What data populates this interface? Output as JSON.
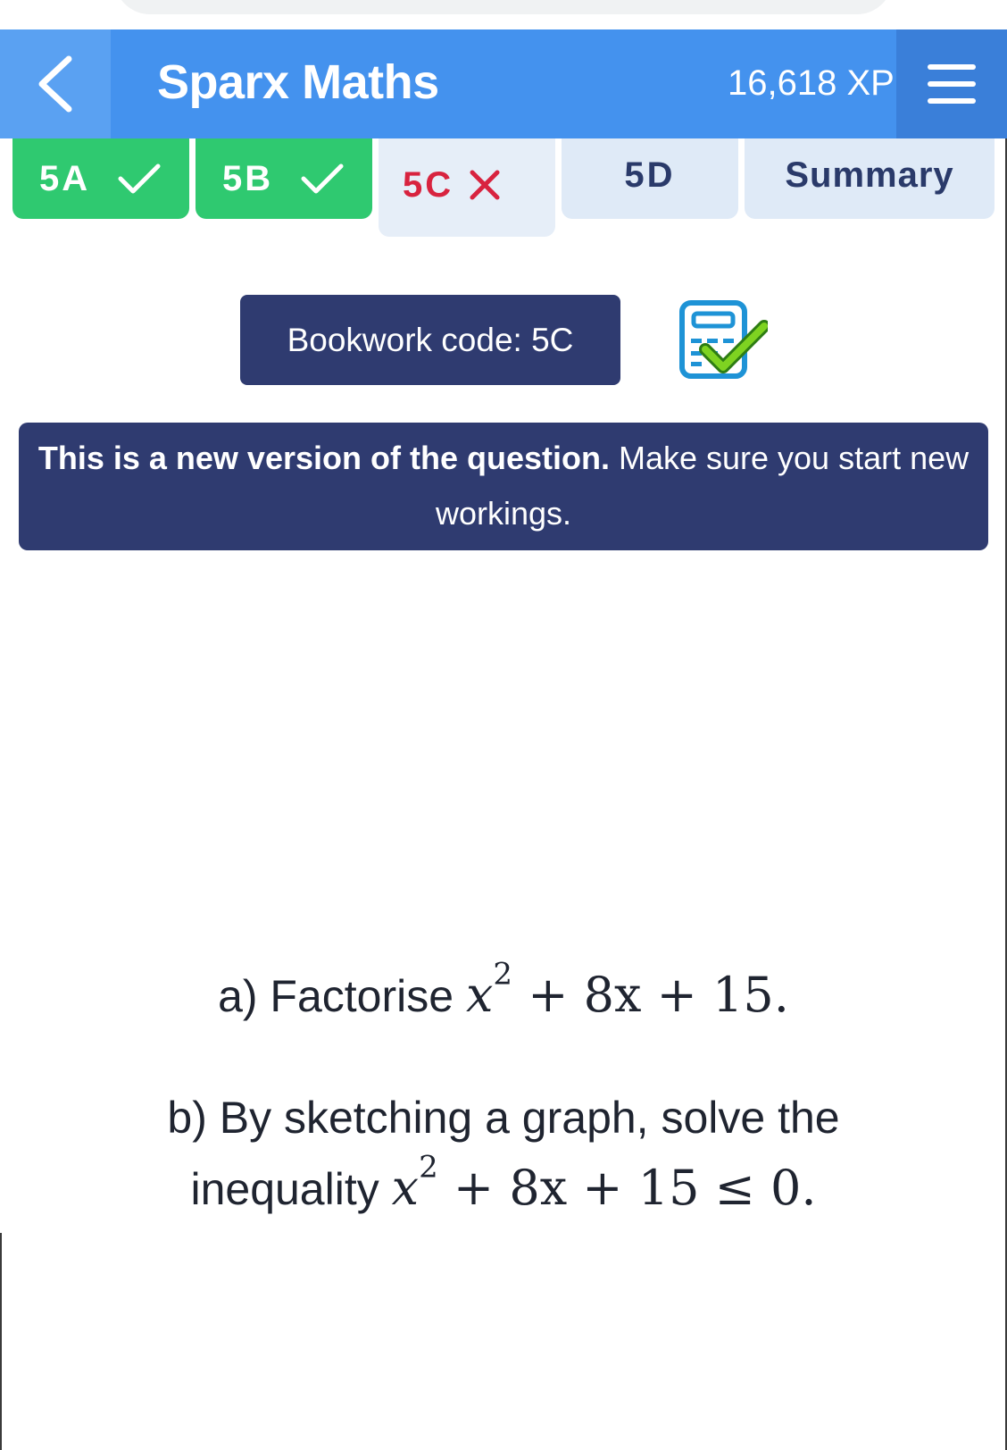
{
  "header": {
    "title": "Sparx Maths",
    "xp": "16,618 XP"
  },
  "tabs": [
    {
      "label": "5A",
      "status": "done"
    },
    {
      "label": "5B",
      "status": "done"
    },
    {
      "label": "5C",
      "status": "wrong"
    },
    {
      "label": "5D",
      "status": "pending"
    },
    {
      "label": "Summary",
      "status": "pending"
    }
  ],
  "bookwork": {
    "text": "Bookwork code: 5C"
  },
  "notice": {
    "bold": "This is a new version of the question.",
    "rest": " Make sure you start new workings."
  },
  "question": {
    "a_prefix": "a) Factorise",
    "a_expr_base": "x",
    "a_expr_exp": "2",
    "a_expr_rest": "+ 8x + 15.",
    "b_line1": "b) By sketching a graph, solve the",
    "b_prefix": "inequality",
    "b_expr_base": "x",
    "b_expr_exp": "2",
    "b_expr_rest": "+ 8x + 15 ≤ 0."
  },
  "colors": {
    "header": "#4492ee",
    "done_tab": "#2fc970",
    "wrong_mark": "#d8233f",
    "dark_panel": "#2f3b70"
  }
}
